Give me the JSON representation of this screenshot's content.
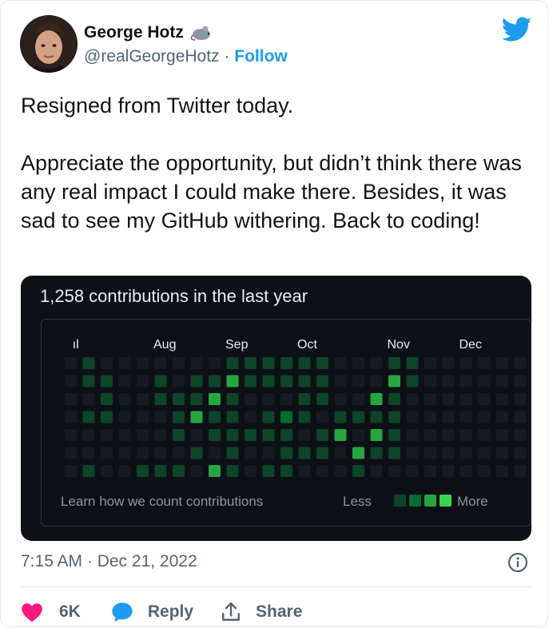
{
  "author": {
    "name": "George Hotz",
    "handle": "@realGeorgeHotz",
    "separator": "·",
    "follow_label": "Follow"
  },
  "tweet": {
    "lines": [
      "Resigned from Twitter today.",
      "Appreciate the opportunity, but didn’t think there was any real impact I could make there. Besides, it was sad to see my GitHub withering. Back to coding!"
    ],
    "timestamp": "7:15 AM · Dec 21, 2022"
  },
  "github_panel": {
    "title": "1,258 contributions in the last year",
    "months": [
      "ıl",
      "Aug",
      "Sep",
      "Oct",
      "Nov",
      "Dec"
    ],
    "learn_link": "Learn how we count contributions",
    "legend_less": "Less",
    "legend_more": "More",
    "colors": {
      "bg": "#0d1117",
      "empty": "#161b22",
      "level1": "#0e4429",
      "level2": "#006d32",
      "level3": "#26a641",
      "level4": "#39d353"
    },
    "grid_levels": [
      [
        0,
        1,
        0,
        0,
        0,
        0,
        0,
        0,
        0,
        1,
        1,
        1,
        1,
        1,
        1,
        0,
        0,
        0,
        1,
        1,
        0,
        0,
        0,
        0,
        0,
        0,
        0,
        0,
        0
      ],
      [
        0,
        1,
        1,
        0,
        0,
        1,
        0,
        1,
        1,
        3,
        1,
        1,
        1,
        1,
        1,
        0,
        0,
        0,
        3,
        1,
        0,
        0,
        0,
        0,
        0,
        0,
        0,
        0,
        0
      ],
      [
        0,
        0,
        1,
        0,
        0,
        1,
        1,
        1,
        3,
        1,
        0,
        0,
        0,
        1,
        1,
        0,
        0,
        3,
        1,
        0,
        0,
        0,
        0,
        0,
        0,
        0,
        0,
        0,
        0
      ],
      [
        0,
        1,
        1,
        0,
        0,
        0,
        1,
        3,
        1,
        1,
        0,
        1,
        2,
        1,
        0,
        1,
        1,
        1,
        1,
        0,
        0,
        0,
        0,
        0,
        0,
        0,
        0,
        0,
        0
      ],
      [
        0,
        0,
        0,
        0,
        0,
        0,
        1,
        0,
        1,
        1,
        1,
        1,
        1,
        0,
        1,
        3,
        0,
        3,
        1,
        0,
        0,
        0,
        0,
        0,
        0,
        0,
        0,
        0,
        0
      ],
      [
        0,
        0,
        0,
        0,
        0,
        0,
        0,
        1,
        0,
        1,
        0,
        0,
        1,
        1,
        1,
        0,
        3,
        1,
        1,
        0,
        0,
        0,
        0,
        0,
        0,
        0,
        0,
        0,
        0
      ],
      [
        0,
        1,
        0,
        0,
        1,
        1,
        1,
        0,
        3,
        1,
        0,
        1,
        1,
        0,
        0,
        0,
        1,
        0,
        0,
        0,
        0,
        0,
        0,
        0,
        0,
        0,
        0,
        0,
        0
      ]
    ]
  },
  "actions": {
    "like_count": "6K",
    "reply_label": "Reply",
    "share_label": "Share"
  }
}
